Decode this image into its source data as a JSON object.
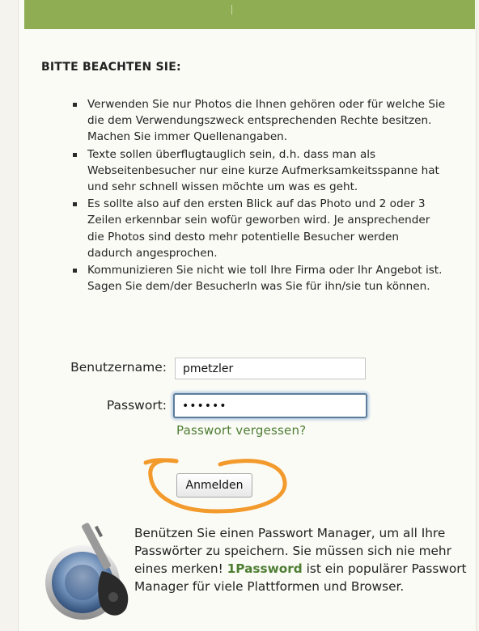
{
  "notice": {
    "title": "BITTE BEACHTEN SIE:",
    "items": [
      "Verwenden Sie nur Photos die Ihnen gehören oder für welche Sie die dem Verwendungszweck entsprechenden Rechte besitzen. Machen Sie immer Quellenangaben.",
      "Texte sollen überflugtauglich sein, d.h. dass man als Webseitenbesucher nur eine kurze Aufmerksamkeitsspanne hat und sehr schnell wissen möchte um was es geht.",
      "Es sollte also auf den ersten Blick auf das Photo und 2 oder 3 Zeilen erkennbar sein wofür geworben wird. Je ansprechender die Photos sind desto mehr potentielle Besucher werden dadurch angesprochen.",
      "Kommunizieren Sie nicht wie toll Ihre Firma oder Ihr Angebot ist. Sagen Sie dem/der BesucherIn was Sie für ihn/sie tun können."
    ]
  },
  "login": {
    "username_label": "Benutzername:",
    "username_value": "pmetzler",
    "password_label": "Passwort:",
    "password_value": "••••••",
    "forgot_link": "Passwort vergessen?",
    "submit_label": "Anmelden"
  },
  "promo": {
    "text_before": "Benützen Sie einen Passwort Manager, um all Ihre Passwörter zu speichern. Sie müssen sich nie mehr eines merken! ",
    "brand": "1Password",
    "text_after": " ist ein populärer Passwort Manager für viele Plattformen und Browser.",
    "icon": "1password-keyhole-icon"
  },
  "colors": {
    "header_bar": "#8fae54",
    "link_green": "#4d7d32",
    "highlight_orange": "#f39a2c",
    "panel_bg": "#fbfbf6"
  }
}
